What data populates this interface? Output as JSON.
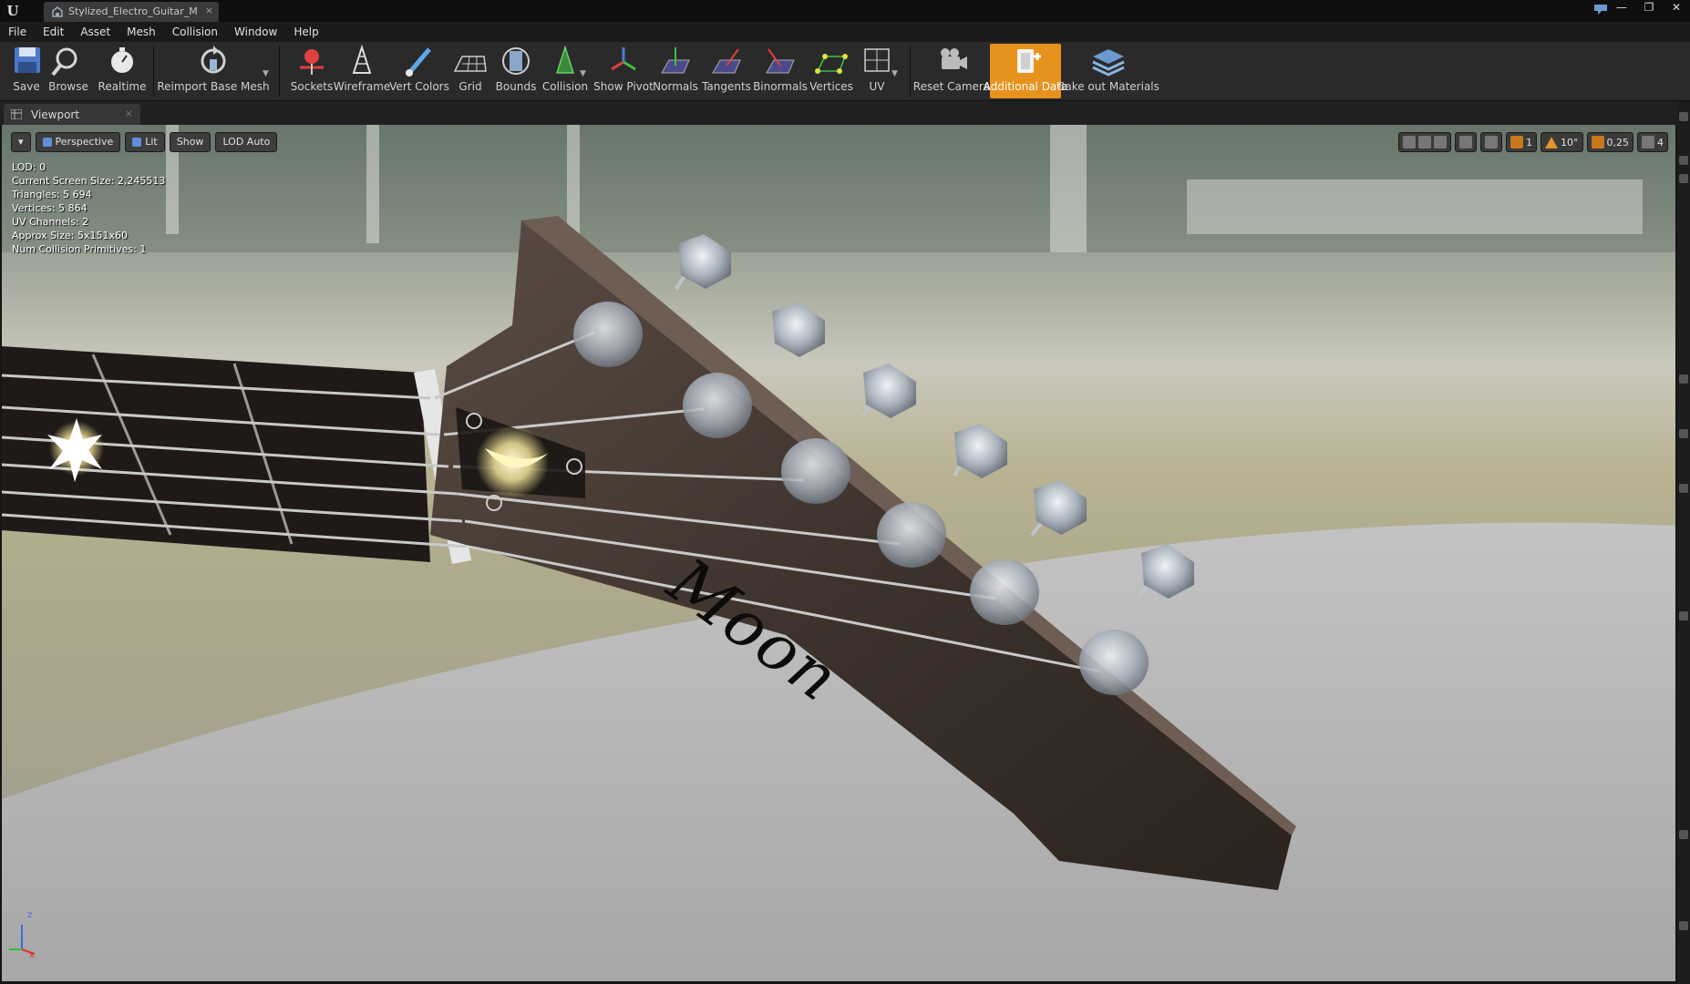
{
  "window": {
    "tab_title": "Stylized_Electro_Guitar_M",
    "tab_close": "×",
    "controls": [
      "—",
      "❐",
      "✕"
    ]
  },
  "menu": [
    "File",
    "Edit",
    "Asset",
    "Mesh",
    "Collision",
    "Window",
    "Help"
  ],
  "toolbar": {
    "buttons": [
      {
        "id": "save",
        "label": "Save",
        "icon": "save-icon"
      },
      {
        "id": "browse",
        "label": "Browse",
        "icon": "browse-icon"
      },
      {
        "id": "realtime",
        "label": "Realtime",
        "icon": "realtime-icon"
      },
      {
        "id": "reimport",
        "label": "Reimport Base Mesh",
        "icon": "reimport-icon"
      },
      {
        "id": "sockets",
        "label": "Sockets",
        "icon": "sockets-icon"
      },
      {
        "id": "wireframe",
        "label": "Wireframe",
        "icon": "wireframe-icon"
      },
      {
        "id": "vertcolors",
        "label": "Vert Colors",
        "icon": "vert-colors-icon"
      },
      {
        "id": "grid",
        "label": "Grid",
        "icon": "grid-icon"
      },
      {
        "id": "bounds",
        "label": "Bounds",
        "icon": "bounds-icon"
      },
      {
        "id": "collision",
        "label": "Collision",
        "icon": "collision-icon"
      },
      {
        "id": "showpivot",
        "label": "Show Pivot",
        "icon": "pivot-icon"
      },
      {
        "id": "normals",
        "label": "Normals",
        "icon": "normals-icon"
      },
      {
        "id": "tangents",
        "label": "Tangents",
        "icon": "tangents-icon"
      },
      {
        "id": "binormals",
        "label": "Binormals",
        "icon": "binormals-icon"
      },
      {
        "id": "vertices",
        "label": "Vertices",
        "icon": "vertices-icon"
      },
      {
        "id": "uv",
        "label": "UV",
        "icon": "uv-icon"
      },
      {
        "id": "resetcamera",
        "label": "Reset Camera",
        "icon": "reset-camera-icon"
      },
      {
        "id": "additionaldata",
        "label": "Additional Data",
        "icon": "additional-data-icon",
        "active": true
      },
      {
        "id": "bake",
        "label": "Bake out Materials",
        "icon": "bake-materials-icon"
      }
    ]
  },
  "viewport_tab": {
    "label": "Viewport",
    "close": "×"
  },
  "viewport_toolbar": {
    "menu_arrow": "▾",
    "perspective": "Perspective",
    "lit": "Lit",
    "show": "Show",
    "lod": "LOD Auto",
    "rotation_snap": "10°",
    "scale_snap": "0,25",
    "camera_speed": "4",
    "grid_snap_value": "1"
  },
  "stats": [
    "LOD:  0",
    "Current Screen Size:  2,245513",
    "Triangles:  5 694",
    "Vertices:  5 864",
    "UV Channels:  2",
    "Approx Size: 5x151x60",
    "Num Collision Primitives:  1"
  ],
  "scene": {
    "headstock_text": "Moon",
    "axis_labels": {
      "z": "z",
      "x": "x"
    }
  },
  "colors": {
    "accent": "#e8921e",
    "toolbar_bg": "#2a2a2a",
    "menu_bg": "#1a1a1a"
  }
}
